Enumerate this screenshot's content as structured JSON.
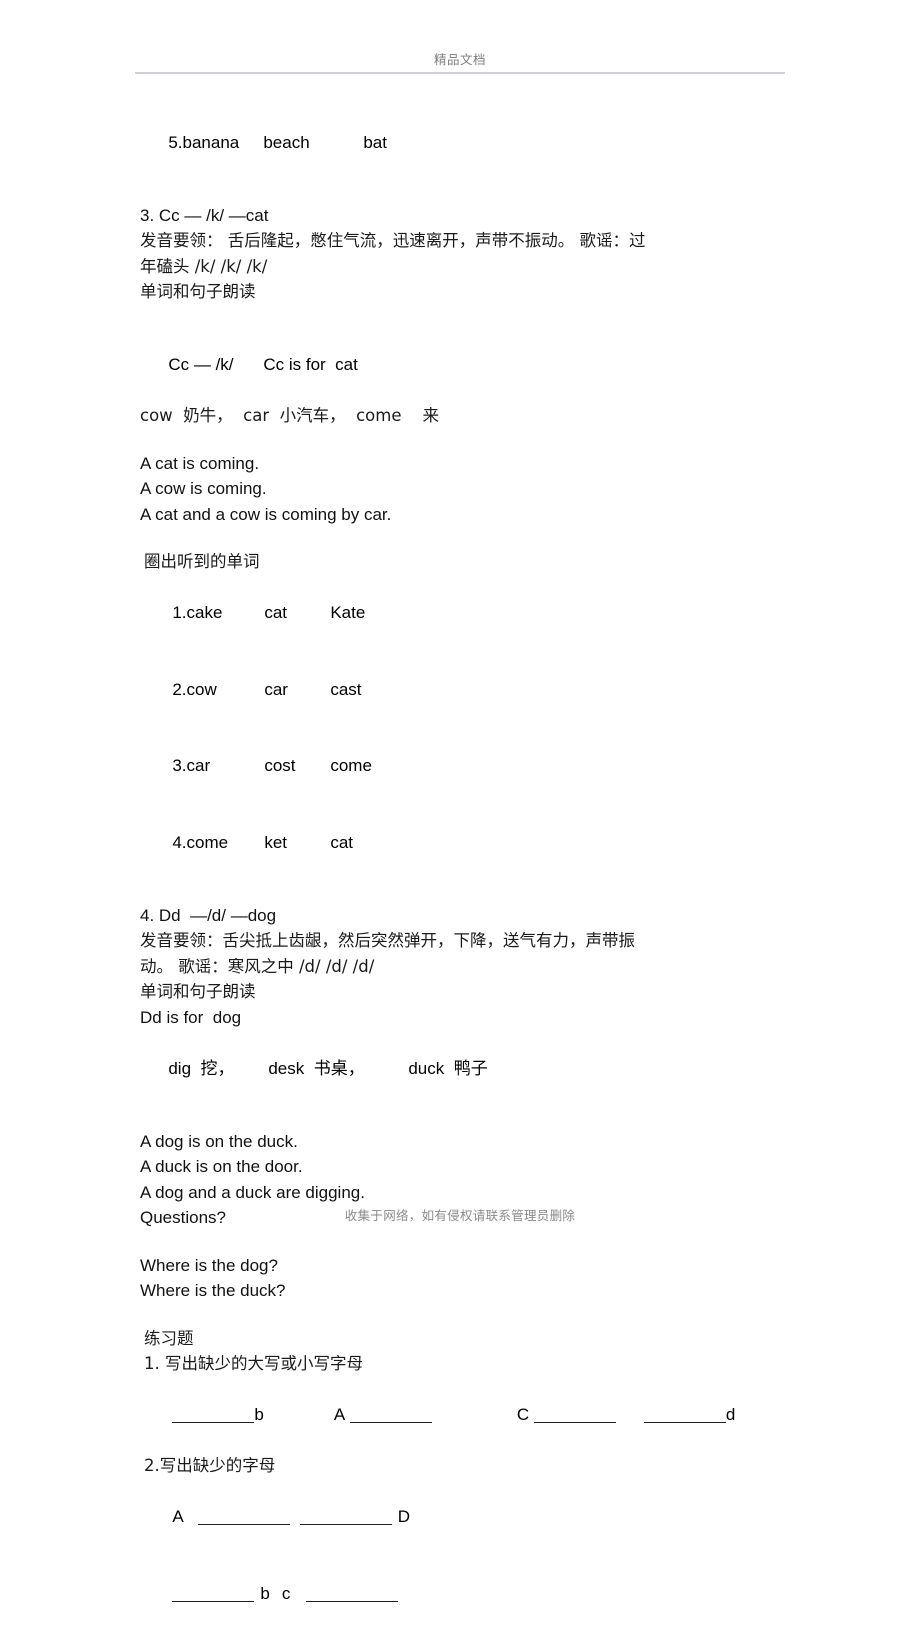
{
  "header": {
    "title": "精品文档"
  },
  "footer": {
    "text": "收集于网络，如有侵权请联系管理员删除"
  },
  "content": {
    "top_word_row": {
      "col1": "5.banana",
      "col2": "beach",
      "col3": "bat"
    },
    "section_c": {
      "heading": "3. Cc — /k/ —cat",
      "pronunciation_tip_line1": "发音要领： 舌后隆起，憋住气流，迅速离开，声带不振动。 歌谣：过",
      "pronunciation_tip_line2": "年磕头 /k/  /k/  /k/",
      "reading_label": "单词和句子朗读",
      "letter_sound": "Cc — /k/",
      "letter_is_for": "Cc is for  cat",
      "vocab_line": "cow  奶牛，  car  小汽车，  come    来",
      "sentences": [
        "A cat is coming.",
        "A cow is coming.",
        "A cat and a cow is coming by car."
      ],
      "exercise_title": "圈出听到的单词",
      "exercise_rows": [
        {
          "col1": "1.cake",
          "col2": "cat",
          "col3": "Kate"
        },
        {
          "col1": "2.cow",
          "col2": "car",
          "col3": "cast"
        },
        {
          "col1": "3.car",
          "col2": "cost",
          "col3": "come"
        },
        {
          "col1": "4.come",
          "col2": "ket",
          "col3": "cat"
        }
      ]
    },
    "section_d": {
      "heading": "4. Dd  —/d/ —dog",
      "pronunciation_tip_line1": "发音要领：舌尖抵上齿龈，然后突然弹开，下降，送气有力，声带振",
      "pronunciation_tip_line2": "动。 歌谣：寒风之中 /d/  /d/  /d/",
      "reading_label": "单词和句子朗读",
      "letter_is_for": "Dd is for  dog",
      "vocab_word1": "dig  挖，",
      "vocab_word2": "desk  书桌，",
      "vocab_word3": "duck  鸭子",
      "sentences": [
        "A dog is on the duck.",
        "A duck is on the door.",
        "A dog and a duck are digging.",
        "Questions?"
      ],
      "questions": [
        "Where is the dog?",
        "Where is the duck?"
      ]
    },
    "exercises": {
      "title": "练习题",
      "q1_title": "1. 写出缺少的大写或小写字母",
      "q1_letters": {
        "letter1": "b",
        "letter2": "A",
        "letter3": "C",
        "letter4": "d"
      },
      "q2_title": "2.写出缺少的字母",
      "q2_row1": {
        "letter_start": "A",
        "letter_end": "D"
      },
      "q2_row2": {
        "letter_b": "b",
        "letter_c": "c"
      }
    }
  }
}
